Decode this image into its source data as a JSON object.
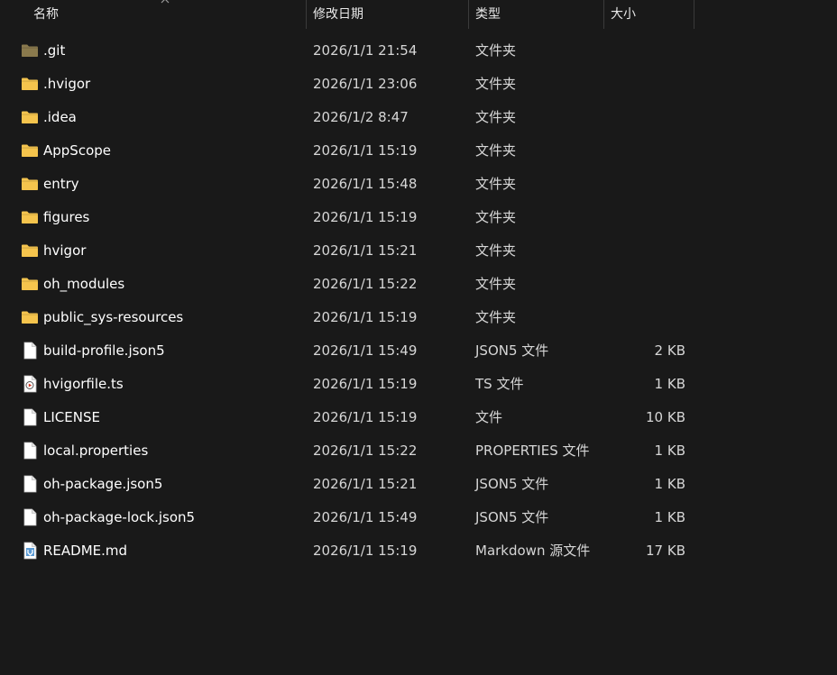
{
  "columns": {
    "name": "名称",
    "date": "修改日期",
    "type": "类型",
    "size": "大小"
  },
  "sort": {
    "column": "name",
    "direction": "ascending",
    "icon": "chevron-up-icon"
  },
  "colors": {
    "background": "#191919",
    "folder": "#f4c44e",
    "git_folder": "#8a7a4e",
    "file": "#ffffff"
  },
  "files": [
    {
      "name": ".git",
      "date": "2026/1/1 21:54",
      "type": "文件夹",
      "size": "",
      "icon": "folder-hidden-icon"
    },
    {
      "name": ".hvigor",
      "date": "2026/1/1 23:06",
      "type": "文件夹",
      "size": "",
      "icon": "folder-icon"
    },
    {
      "name": ".idea",
      "date": "2026/1/2 8:47",
      "type": "文件夹",
      "size": "",
      "icon": "folder-icon"
    },
    {
      "name": "AppScope",
      "date": "2026/1/1 15:19",
      "type": "文件夹",
      "size": "",
      "icon": "folder-icon"
    },
    {
      "name": "entry",
      "date": "2026/1/1 15:48",
      "type": "文件夹",
      "size": "",
      "icon": "folder-icon"
    },
    {
      "name": "figures",
      "date": "2026/1/1 15:19",
      "type": "文件夹",
      "size": "",
      "icon": "folder-icon"
    },
    {
      "name": "hvigor",
      "date": "2026/1/1 15:21",
      "type": "文件夹",
      "size": "",
      "icon": "folder-icon"
    },
    {
      "name": "oh_modules",
      "date": "2026/1/1 15:22",
      "type": "文件夹",
      "size": "",
      "icon": "folder-icon"
    },
    {
      "name": "public_sys-resources",
      "date": "2026/1/1 15:19",
      "type": "文件夹",
      "size": "",
      "icon": "folder-icon"
    },
    {
      "name": "build-profile.json5",
      "date": "2026/1/1 15:49",
      "type": "JSON5 文件",
      "size": "2 KB",
      "icon": "file-icon"
    },
    {
      "name": "hvigorfile.ts",
      "date": "2026/1/1 15:19",
      "type": "TS 文件",
      "size": "1 KB",
      "icon": "ts-file-icon"
    },
    {
      "name": "LICENSE",
      "date": "2026/1/1 15:19",
      "type": "文件",
      "size": "10 KB",
      "icon": "file-icon"
    },
    {
      "name": "local.properties",
      "date": "2026/1/1 15:22",
      "type": "PROPERTIES 文件",
      "size": "1 KB",
      "icon": "file-icon"
    },
    {
      "name": "oh-package.json5",
      "date": "2026/1/1 15:21",
      "type": "JSON5 文件",
      "size": "1 KB",
      "icon": "file-icon"
    },
    {
      "name": "oh-package-lock.json5",
      "date": "2026/1/1 15:49",
      "type": "JSON5 文件",
      "size": "1 KB",
      "icon": "file-icon"
    },
    {
      "name": "README.md",
      "date": "2026/1/1 15:19",
      "type": "Markdown 源文件",
      "size": "17 KB",
      "icon": "markdown-file-icon"
    }
  ]
}
